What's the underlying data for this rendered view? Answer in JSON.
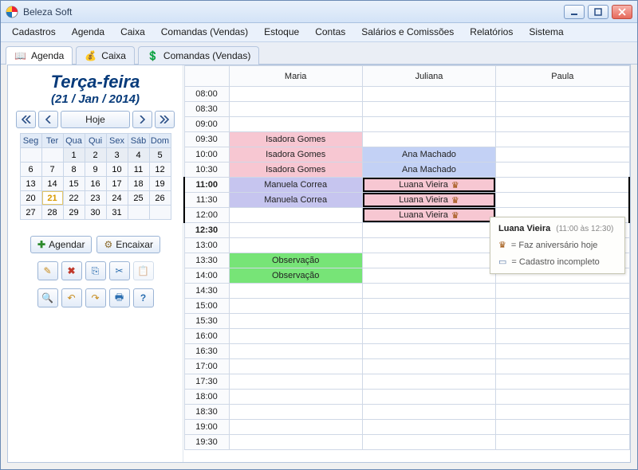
{
  "window": {
    "title": "Beleza Soft"
  },
  "menu": [
    "Cadastros",
    "Agenda",
    "Caixa",
    "Comandas (Vendas)",
    "Estoque",
    "Contas",
    "Salários e Comissões",
    "Relatórios",
    "Sistema"
  ],
  "tabs": [
    {
      "label": "Agenda",
      "active": true
    },
    {
      "label": "Caixa",
      "active": false
    },
    {
      "label": "Comandas (Vendas)",
      "active": false
    }
  ],
  "left": {
    "day_name": "Terça-feira",
    "day_date": "(21 / Jan / 2014)",
    "today_label": "Hoje",
    "dow": [
      "Seg",
      "Ter",
      "Qua",
      "Qui",
      "Sex",
      "Sáb",
      "Dom"
    ],
    "weeks": [
      [
        "",
        "",
        "1",
        "2",
        "3",
        "4",
        "5"
      ],
      [
        "6",
        "7",
        "8",
        "9",
        "10",
        "11",
        "12"
      ],
      [
        "13",
        "14",
        "15",
        "16",
        "17",
        "18",
        "19"
      ],
      [
        "20",
        "21",
        "22",
        "23",
        "24",
        "25",
        "26"
      ],
      [
        "27",
        "28",
        "29",
        "30",
        "31",
        "",
        ""
      ]
    ],
    "selected_day": "21",
    "agendar_label": "Agendar",
    "encaixar_label": "Encaixar"
  },
  "grid": {
    "columns": [
      "Maria",
      "Juliana",
      "Paula"
    ],
    "times": [
      "08:00",
      "08:30",
      "09:00",
      "09:30",
      "10:00",
      "10:30",
      "11:00",
      "11:30",
      "12:00",
      "12:30",
      "13:00",
      "13:30",
      "14:00",
      "14:30",
      "15:00",
      "15:30",
      "16:00",
      "16:30",
      "17:00",
      "17:30",
      "18:00",
      "18:30",
      "19:00",
      "19:30"
    ],
    "bold_times": [
      "11:00",
      "12:30"
    ],
    "appointments": {
      "09:30": {
        "Maria": {
          "text": "Isadora Gomes",
          "color": "pink"
        }
      },
      "10:00": {
        "Maria": {
          "text": "Isadora Gomes",
          "color": "pink"
        },
        "Juliana": {
          "text": "Ana Machado",
          "color": "blue"
        }
      },
      "10:30": {
        "Maria": {
          "text": "Isadora Gomes",
          "color": "pink"
        },
        "Juliana": {
          "text": "Ana Machado",
          "color": "blue"
        }
      },
      "11:00": {
        "Maria": {
          "text": "Manuela Correa",
          "color": "purple"
        },
        "Juliana": {
          "text": "Luana Vieira",
          "color": "pink",
          "cake": true,
          "selected": true
        }
      },
      "11:30": {
        "Maria": {
          "text": "Manuela Correa",
          "color": "purple"
        },
        "Juliana": {
          "text": "Luana Vieira",
          "color": "pink",
          "cake": true,
          "selected": true
        }
      },
      "12:00": {
        "Juliana": {
          "text": "Luana Vieira",
          "color": "pink",
          "cake": true,
          "selected": true
        }
      },
      "13:30": {
        "Maria": {
          "text": "Observação",
          "color": "green"
        }
      },
      "14:00": {
        "Maria": {
          "text": "Observação",
          "color": "green"
        }
      }
    },
    "selection_rows": [
      "11:00",
      "11:30",
      "12:00"
    ]
  },
  "tooltip": {
    "name": "Luana Vieira",
    "time": "(11:00 às 12:30)",
    "line1": "= Faz aniversário hoje",
    "line2": "= Cadastro incompleto"
  }
}
